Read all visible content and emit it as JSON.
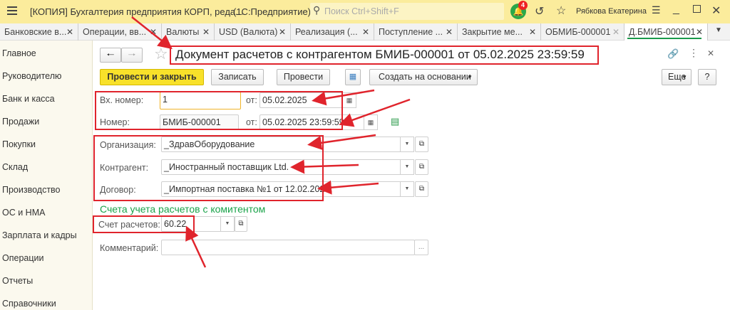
{
  "window": {
    "title": "[КОПИЯ] Бухгалтерия предприятия КОРП, реда...",
    "app": "(1С:Предприятие)",
    "search_placeholder": "Поиск Ctrl+Shift+F",
    "notifications": "4",
    "user": "Рябкова Екатерина"
  },
  "tabs": [
    "Банковские в...",
    "Операции, вв...",
    "Валюты",
    "USD (Валюта)",
    "Реализация (...",
    "Поступление ...",
    "Закрытие ме...",
    "ОБМИБ-000001",
    "Д.БМИБ-000001"
  ],
  "sidebar": [
    "Главное",
    "Руководителю",
    "Банк и касса",
    "Продажи",
    "Покупки",
    "Склад",
    "Производство",
    "ОС и НМА",
    "Зарплата и кадры",
    "Операции",
    "Отчеты",
    "Справочники"
  ],
  "document": {
    "title": "Документ расчетов с контрагентом БМИБ-000001 от 05.02.2025 23:59:59"
  },
  "toolbar": {
    "post_close": "Провести и закрыть",
    "save": "Записать",
    "post": "Провести",
    "create_based": "Создать на основании",
    "more": "Еще",
    "help": "?"
  },
  "form": {
    "in_number_label": "Вх. номер:",
    "in_number": "1",
    "from_label": "от:",
    "in_date": "05.02.2025",
    "number_label": "Номер:",
    "number": "БМИБ-000001",
    "date": "05.02.2025 23:59:59",
    "org_label": "Организация:",
    "org": "_ЗдравОборудование",
    "counterparty_label": "Контрагент:",
    "counterparty": "_Иностранный поставщик Ltd.",
    "contract_label": "Договор:",
    "contract": "_Импортная поставка №1 от 12.02.2025",
    "section": "Счета учета расчетов с комитентом",
    "account_label": "Счет расчетов:",
    "account": "60.22",
    "comment_label": "Комментарий:",
    "comment": "",
    "comment_btn": "..."
  },
  "colors": {
    "topbar": "#fbec9c",
    "primary": "#f8e12a",
    "section": "#1aa34a",
    "annotation": "#e0242c"
  }
}
